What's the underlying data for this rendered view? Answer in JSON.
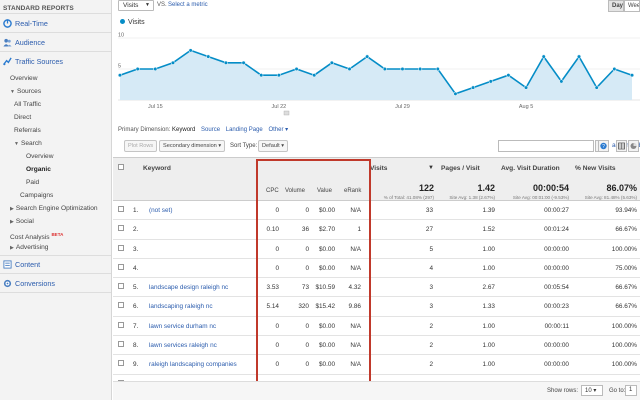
{
  "sidebar": {
    "header": "STANDARD REPORTS",
    "realtime": "Real-Time",
    "audience": "Audience",
    "traffic_sources": "Traffic Sources",
    "items": [
      {
        "label": "Overview"
      },
      {
        "label": "Sources"
      },
      {
        "label": "All Traffic"
      },
      {
        "label": "Direct"
      },
      {
        "label": "Referrals"
      },
      {
        "label": "Search"
      },
      {
        "label": "Overview"
      },
      {
        "label": "Organic"
      },
      {
        "label": "Paid"
      },
      {
        "label": "Campaigns"
      },
      {
        "label": "Search Engine Optimization"
      },
      {
        "label": "Social"
      },
      {
        "label": "Cost Analysis",
        "badge": "BETA"
      },
      {
        "label": "Advertising"
      }
    ],
    "content": "Content",
    "conversions": "Conversions"
  },
  "topbar": {
    "metric_select": "Visits",
    "vs": "VS.",
    "select_metric": "Select a metric",
    "period_day": "Day",
    "period_week": "Week"
  },
  "chart_data": {
    "type": "line",
    "series": [
      {
        "name": "Visits",
        "values": [
          4,
          5,
          5,
          6,
          8,
          7,
          6,
          6,
          4,
          4,
          5,
          4,
          6,
          5,
          7,
          5,
          5,
          5,
          5,
          1,
          2,
          3,
          4,
          2,
          7,
          3,
          7,
          2,
          5,
          4
        ]
      }
    ],
    "y_ticks": [
      "10",
      "5"
    ],
    "ylim": [
      0,
      10
    ],
    "x_ticks": [
      {
        "label": "Jul 15",
        "index": 2
      },
      {
        "label": "Jul 22",
        "index": 9
      },
      {
        "label": "Jul 29",
        "index": 16
      },
      {
        "label": "Aug 5",
        "index": 23
      }
    ],
    "color": "#058dc7",
    "fill": "#d6eaf6"
  },
  "dimension": {
    "prefix": "Primary Dimension:",
    "current": "Keyword",
    "options": [
      "Source",
      "Landing Page",
      "Other ▾"
    ]
  },
  "toolbar": {
    "plot_rows": "Plot Rows",
    "secondary_dimension": "Secondary dimension ▾",
    "sort_type": "Sort Type:",
    "sort_default": "Default ▾",
    "advanced": "advanced"
  },
  "table": {
    "headers": {
      "keyword": "Keyword",
      "cpc": "CPC",
      "volume": "Volume",
      "value": "Value",
      "erank": "eRank",
      "visits": "Visits",
      "pages_visit": "Pages / Visit",
      "avg_duration": "Avg. Visit Duration",
      "new_visits": "% New Visits"
    },
    "totals": {
      "visits": "122",
      "visits_sub": "% of Total: 41.08% (297)",
      "pages_visit": "1.42",
      "pages_visit_sub": "Site Avg: 1.38 (2.67%)",
      "avg_duration": "00:00:54",
      "avg_duration_sub": "Site Avg: 00:01:00 (-9.53%)",
      "new_visits": "86.07%",
      "new_visits_sub": "Site Avg: 81.48% (5.63%)"
    },
    "rows": [
      {
        "num": "1.",
        "keyword": "(not set)",
        "cpc": "0",
        "volume": "0",
        "value": "$0.00",
        "erank": "N/A",
        "visits": "33",
        "pages": "1.39",
        "duration": "00:00:27",
        "new": "93.94%"
      },
      {
        "num": "2.",
        "keyword": "",
        "cpc": "0.10",
        "volume": "36",
        "value": "$2.70",
        "erank": "1",
        "visits": "27",
        "pages": "1.52",
        "duration": "00:01:24",
        "new": "66.67%"
      },
      {
        "num": "3.",
        "keyword": "",
        "cpc": "0",
        "volume": "0",
        "value": "$0.00",
        "erank": "N/A",
        "visits": "5",
        "pages": "1.00",
        "duration": "00:00:00",
        "new": "100.00%"
      },
      {
        "num": "4.",
        "keyword": "",
        "cpc": "0",
        "volume": "0",
        "value": "$0.00",
        "erank": "N/A",
        "visits": "4",
        "pages": "1.00",
        "duration": "00:00:00",
        "new": "75.00%"
      },
      {
        "num": "5.",
        "keyword": "landscape design raleigh nc",
        "cpc": "3.53",
        "volume": "73",
        "value": "$10.59",
        "erank": "4.32",
        "visits": "3",
        "pages": "2.67",
        "duration": "00:05:54",
        "new": "66.67%"
      },
      {
        "num": "6.",
        "keyword": "landscaping raleigh nc",
        "cpc": "5.14",
        "volume": "320",
        "value": "$15.42",
        "erank": "9.86",
        "visits": "3",
        "pages": "1.33",
        "duration": "00:00:23",
        "new": "66.67%"
      },
      {
        "num": "7.",
        "keyword": "lawn service durham nc",
        "cpc": "0",
        "volume": "0",
        "value": "$0.00",
        "erank": "N/A",
        "visits": "2",
        "pages": "1.00",
        "duration": "00:00:11",
        "new": "100.00%"
      },
      {
        "num": "8.",
        "keyword": "lawn services raleigh nc",
        "cpc": "0",
        "volume": "0",
        "value": "$0.00",
        "erank": "N/A",
        "visits": "2",
        "pages": "1.00",
        "duration": "00:00:00",
        "new": "100.00%"
      },
      {
        "num": "9.",
        "keyword": "raleigh landscaping companies",
        "cpc": "0",
        "volume": "0",
        "value": "$0.00",
        "erank": "N/A",
        "visits": "2",
        "pages": "1.00",
        "duration": "00:00:00",
        "new": "100.00%"
      },
      {
        "num": "10.",
        "keyword": "",
        "cpc": "0",
        "volume": "0",
        "value": "$0.00",
        "erank": "N/A",
        "visits": "2",
        "pages": "1.00",
        "duration": "00:00:00",
        "new": "100.00%"
      }
    ]
  },
  "footer": {
    "show_rows": "Show rows:",
    "show_rows_value": "10 ▾",
    "go_to": "Go to:",
    "go_to_value": "1"
  }
}
